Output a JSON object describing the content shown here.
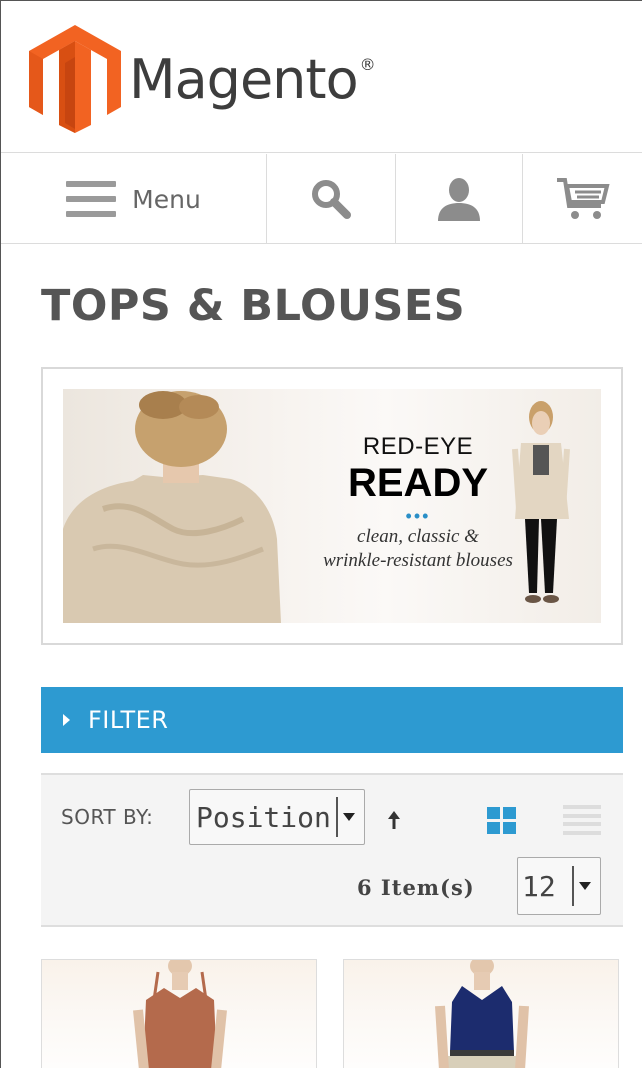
{
  "header": {
    "brand_name": "Magento",
    "brand_reg": "®"
  },
  "nav": {
    "menu_label": "Menu",
    "icons": [
      "hamburger-icon",
      "search-icon",
      "account-icon",
      "cart-icon"
    ]
  },
  "page": {
    "title": "TOPS & BLOUSES"
  },
  "banner": {
    "line1": "RED-EYE",
    "line2": "READY",
    "dots": "•••",
    "line3": "clean, classic &",
    "line4": "wrinkle-resistant blouses"
  },
  "filter": {
    "label": "FILTER"
  },
  "toolbar": {
    "sort_label": "SORT BY:",
    "sort_value": "Position",
    "items_count": "6 Item(s)",
    "limit_value": "12",
    "view_mode": "grid"
  },
  "colors": {
    "brand_orange": "#f26322",
    "accent_blue": "#2d9ad1",
    "text_dark": "#555555"
  }
}
